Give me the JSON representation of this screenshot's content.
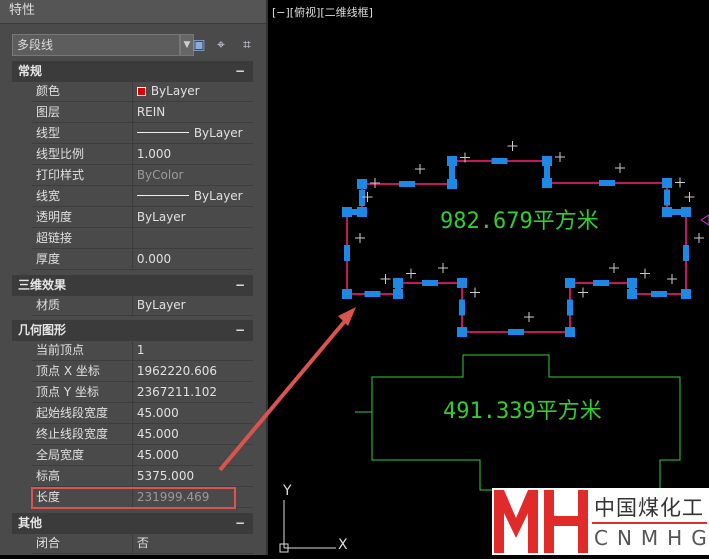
{
  "panel": {
    "title": "特性",
    "object_type": "多段线"
  },
  "toolbar": {
    "icons": [
      "quick-select-icon",
      "select-objects-icon",
      "toggle-pickadd-icon"
    ]
  },
  "sections": {
    "general": {
      "title": "常规",
      "collapse": "−",
      "rows": [
        {
          "k": "颜色",
          "v": "ByLayer"
        },
        {
          "k": "图层",
          "v": "REIN"
        },
        {
          "k": "线型",
          "v": "ByLayer"
        },
        {
          "k": "线型比例",
          "v": "1.000"
        },
        {
          "k": "打印样式",
          "v": "ByColor"
        },
        {
          "k": "线宽",
          "v": "ByLayer"
        },
        {
          "k": "透明度",
          "v": "ByLayer"
        },
        {
          "k": "超链接",
          "v": ""
        },
        {
          "k": "厚度",
          "v": "0.000"
        }
      ]
    },
    "3d": {
      "title": "三维效果",
      "collapse": "−",
      "rows": [
        {
          "k": "材质",
          "v": "ByLayer"
        }
      ]
    },
    "geometry": {
      "title": "几何图形",
      "collapse": "−",
      "rows": [
        {
          "k": "当前顶点",
          "v": "1"
        },
        {
          "k": "顶点 X 坐标",
          "v": "1962220.606"
        },
        {
          "k": "顶点 Y 坐标",
          "v": "2367211.102"
        },
        {
          "k": "起始线段宽度",
          "v": "45.000"
        },
        {
          "k": "终止线段宽度",
          "v": "45.000"
        },
        {
          "k": "全局宽度",
          "v": "45.000"
        },
        {
          "k": "标高",
          "v": "5375.000"
        },
        {
          "k": "长度",
          "v": "231999.469"
        }
      ]
    },
    "misc": {
      "title": "其他",
      "collapse": "−",
      "rows": [
        {
          "k": "闭合",
          "v": "否"
        }
      ]
    }
  },
  "viewport": {
    "label": "[−][俯视][二维线框]",
    "area1": "982.679平方米",
    "area2": "491.339平方米",
    "ucs_x": "X",
    "ucs_y": "Y"
  },
  "logo": {
    "cn": "中国煤化工",
    "en": "CNMHG"
  },
  "colors": {
    "highlight": "#d9534f",
    "selection": "#1e88e5",
    "polyline": "#c2185b",
    "area": "#33cc33"
  }
}
